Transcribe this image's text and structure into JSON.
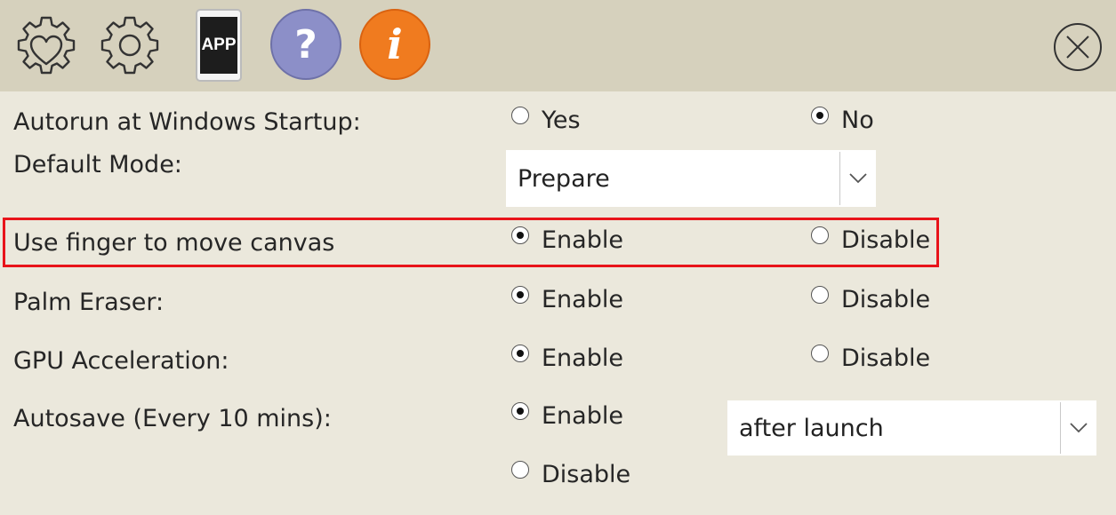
{
  "toolbar": {
    "icons": [
      {
        "name": "settings-heart-icon"
      },
      {
        "name": "settings-gear-icon"
      },
      {
        "name": "app-icon",
        "label": "APP"
      },
      {
        "name": "help-icon",
        "label": "?",
        "color": "#8c8fc8"
      },
      {
        "name": "info-icon",
        "label": "i",
        "color": "#f07b1f"
      }
    ],
    "close_icon": "close-icon"
  },
  "settings": {
    "autorun": {
      "label": "Autorun at Windows Startup:",
      "options": [
        {
          "label": "Yes",
          "checked": false
        },
        {
          "label": "No",
          "checked": true
        }
      ]
    },
    "default_mode": {
      "label": "Default Mode:",
      "value": "Prepare"
    },
    "finger_move": {
      "label": "Use finger to move canvas",
      "options": [
        {
          "label": "Enable",
          "checked": true
        },
        {
          "label": "Disable",
          "checked": false
        }
      ]
    },
    "palm_eraser": {
      "label": "Palm Eraser:",
      "options": [
        {
          "label": "Enable",
          "checked": true
        },
        {
          "label": "Disable",
          "checked": false
        }
      ]
    },
    "gpu": {
      "label": "GPU Acceleration:",
      "options": [
        {
          "label": "Enable",
          "checked": true
        },
        {
          "label": "Disable",
          "checked": false
        }
      ]
    },
    "autosave": {
      "label": "Autosave (Every 10 mins):",
      "options": [
        {
          "label": "Enable",
          "checked": true
        },
        {
          "label": "Disable",
          "checked": false
        }
      ],
      "timing_value": "after launch"
    }
  },
  "colors": {
    "toolbar_bg": "#d6d1bd",
    "panel_bg": "#ebe8dc",
    "highlight": "#e8141a"
  }
}
